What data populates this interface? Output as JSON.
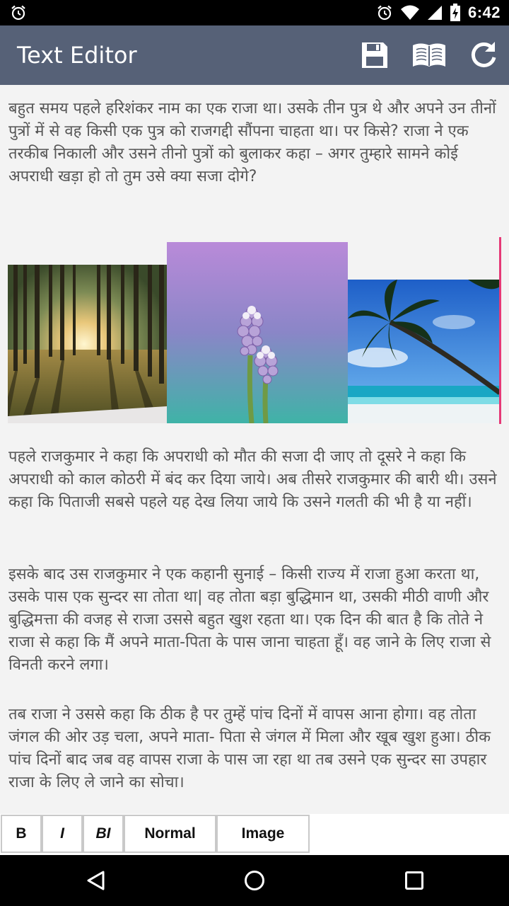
{
  "status_bar": {
    "time": "6:42",
    "left_icon": "alarm-clock-icon",
    "right_icons": [
      "alarm-clock-icon",
      "wifi-icon",
      "signal-icon",
      "battery-charging-icon"
    ]
  },
  "app_bar": {
    "title": "Text Editor",
    "actions": [
      {
        "name": "save",
        "icon": "save-icon"
      },
      {
        "name": "read",
        "icon": "open-book-icon"
      },
      {
        "name": "refresh",
        "icon": "refresh-icon"
      }
    ],
    "color": "#566177"
  },
  "editor": {
    "paragraphs": [
      "बहुत समय पहले हरिशंकर नाम का एक राजा था। उसके तीन पुत्र थे और अपने उन तीनों पुत्रों में से वह किसी एक पुत्र को राजगद्दी सौंपना चाहता था। पर किसे? राजा ने एक तरकीब निकाली और उसने तीनो पुत्रों को बुलाकर कहा – अगर तुम्हारे सामने कोई अपराधी खड़ा हो तो तुम उसे क्या सजा दोगे?",
      "पहले राजकुमार ने कहा कि अपराधी को मौत की सजा दी जाए तो दूसरे ने कहा कि अपराधी को काल कोठरी में बंद कर दिया जाये। अब तीसरे राजकुमार की बारी थी। उसने कहा कि पिताजी सबसे पहले यह देख लिया जाये कि उसने गलती की भी है या नहीं।",
      "इसके बाद उस राजकुमार ने एक कहानी सुनाई – किसी राज्य में राजा हुआ करता था, उसके पास एक सुन्दर सा तोता था| वह तोता बड़ा बुद्धिमान था, उसकी मीठी वाणी और बुद्धिमत्ता की वजह से राजा उससे बहुत खुश रहता था। एक दिन की बात है कि तोते ने राजा से कहा कि मैं अपने माता-पिता के पास जाना चाहता हूँ। वह जाने के लिए राजा से विनती करने लगा।",
      "तब राजा ने उससे कहा कि ठीक है पर तुम्हें पांच दिनों में वापस आना होगा। वह तोता जंगल की ओर उड़ चला, अपने माता- पिता से जंगल में मिला और खूब खुश हुआ। ठीक पांच दिनों बाद जब वह वापस राजा के पास जा रहा था तब उसने एक सुन्दर सा उपहार राजा के लिए ले जाने का सोचा।"
    ],
    "images": [
      "forest-sunlight-image",
      "purple-flower-image",
      "palm-tree-beach-image"
    ],
    "cursor_color": "#e63977",
    "text_color": "#555555"
  },
  "toolbar": {
    "bold_label": "B",
    "italic_label": "I",
    "bold_italic_label": "BI",
    "normal_label": "Normal",
    "image_label": "Image"
  },
  "nav_bar": {
    "icons": [
      "back-triangle-icon",
      "home-circle-icon",
      "recents-square-icon"
    ]
  }
}
